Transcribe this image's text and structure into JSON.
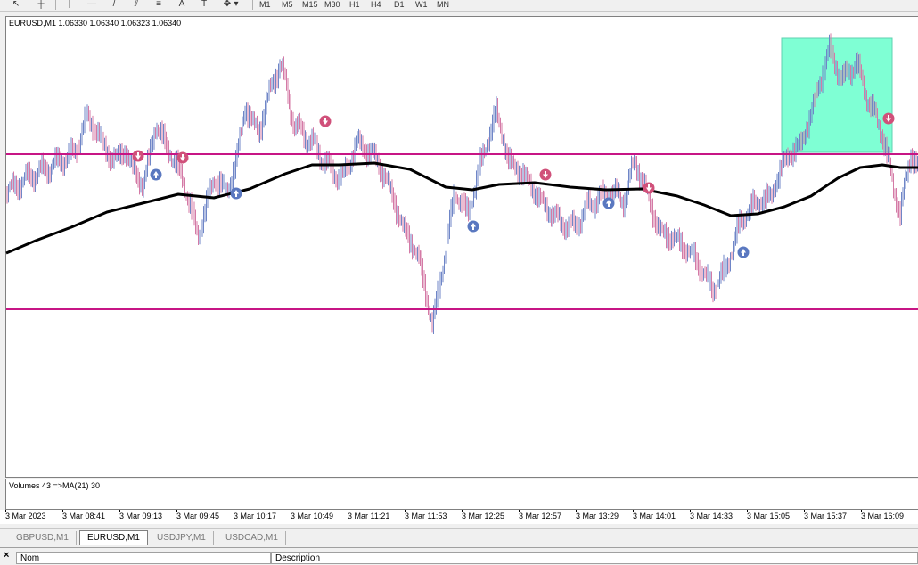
{
  "toolbar": {
    "tools": [
      {
        "name": "cursor-tool-icon",
        "glyph": "↖"
      },
      {
        "name": "crosshair-tool-icon",
        "glyph": "┼"
      },
      {
        "name": "vertical-line-tool-icon",
        "glyph": "|"
      },
      {
        "name": "horizontal-line-tool-icon",
        "glyph": "—"
      },
      {
        "name": "trendline-tool-icon",
        "glyph": "/"
      },
      {
        "name": "channel-tool-icon",
        "glyph": "⫽"
      },
      {
        "name": "fibonacci-tool-icon",
        "glyph": "≡"
      },
      {
        "name": "text-tool-icon",
        "glyph": "A"
      },
      {
        "name": "label-tool-icon",
        "glyph": "T"
      },
      {
        "name": "shapes-tool-icon",
        "glyph": "✥"
      },
      {
        "name": "dropdown-arrow-icon",
        "glyph": "▾"
      }
    ],
    "timeframes": [
      "M1",
      "M5",
      "M15",
      "M30",
      "H1",
      "H4",
      "D1",
      "W1",
      "MN"
    ]
  },
  "chart": {
    "header": "EURUSD,M1  1.06330 1.06340 1.06323 1.06340",
    "colors": {
      "bull": "#6f86c7",
      "bear": "#d47aa6",
      "level": "#c71585",
      "ma": "#000000",
      "zone": "#7fffd4",
      "arrow_up": "#5a78c0",
      "arrow_down": "#d0507a"
    }
  },
  "volumes": {
    "header": "Volumes 43  =>MA(21) 30"
  },
  "time_axis": {
    "labels": [
      "3 Mar 2023",
      "3 Mar 08:41",
      "3 Mar 09:13",
      "3 Mar 09:45",
      "3 Mar 10:17",
      "3 Mar 10:49",
      "3 Mar 11:21",
      "3 Mar 11:53",
      "3 Mar 12:25",
      "3 Mar 12:57",
      "3 Mar 13:29",
      "3 Mar 14:01",
      "3 Mar 14:33",
      "3 Mar 15:05",
      "3 Mar 15:37",
      "3 Mar 16:09"
    ]
  },
  "tabs": [
    {
      "label": "GBPUSD,M1",
      "active": false
    },
    {
      "label": "EURUSD,M1",
      "active": true
    },
    {
      "label": "USDJPY,M1",
      "active": false
    },
    {
      "label": "USDCAD,M1",
      "active": false
    }
  ],
  "bottom_panel": {
    "close_label": "×",
    "columns": [
      "Nom",
      "Description"
    ]
  }
}
